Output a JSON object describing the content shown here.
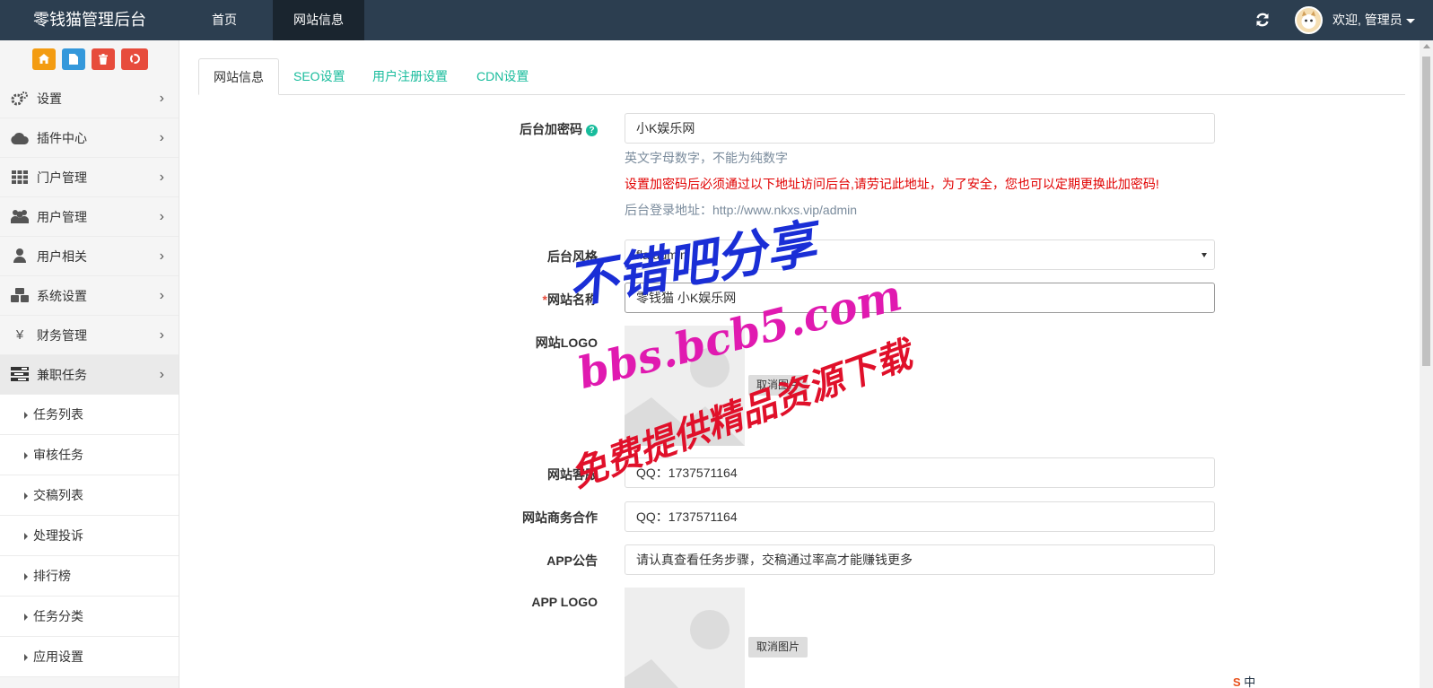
{
  "app": {
    "title": "零钱猫管理后台"
  },
  "topnav": {
    "home": "首页",
    "site_info": "网站信息",
    "welcome": "欢迎, 管理员"
  },
  "sidebar": {
    "items": [
      {
        "label": "设置",
        "icon": "gears-icon"
      },
      {
        "label": "插件中心",
        "icon": "cloud-icon"
      },
      {
        "label": "门户管理",
        "icon": "grid-icon"
      },
      {
        "label": "用户管理",
        "icon": "users-icon"
      },
      {
        "label": "用户相关",
        "icon": "user-icon"
      },
      {
        "label": "系统设置",
        "icon": "cubes-icon"
      },
      {
        "label": "财务管理",
        "icon": "yen-icon"
      },
      {
        "label": "兼职任务",
        "icon": "tasks-icon"
      }
    ],
    "sub_items": [
      "任务列表",
      "审核任务",
      "交稿列表",
      "处理投诉",
      "排行榜",
      "任务分类",
      "应用设置"
    ]
  },
  "tabs": [
    "网站信息",
    "SEO设置",
    "用户注册设置",
    "CDN设置"
  ],
  "form": {
    "admin_code": {
      "label": "后台加密码",
      "value": "小K娱乐网",
      "hint1": "英文字母数字，不能为纯数字",
      "hint2": "设置加密码后必须通过以下地址访问后台,请劳记此地址，为了安全，您也可以定期更换此加密码!",
      "hint3": "后台登录地址：http://www.nkxs.vip/admin"
    },
    "admin_style": {
      "label": "后台风格",
      "value": "flatadmin"
    },
    "site_name": {
      "label": "网站名称",
      "required": "*",
      "value": "零钱猫   小K娱乐网"
    },
    "site_logo": {
      "label": "网站LOGO",
      "cancel": "取消图片"
    },
    "service": {
      "label": "网站客服",
      "value": "QQ：1737571164"
    },
    "business": {
      "label": "网站商务合作",
      "value": "QQ：1737571164"
    },
    "app_notice": {
      "label": "APP公告",
      "value": "请认真查看任务步骤，交稿通过率高才能赚钱更多"
    },
    "app_logo": {
      "label": "APP LOGO",
      "cancel": "取消图片"
    }
  },
  "watermark": {
    "line1": "不错吧分享",
    "line2": "bbs.bcb5.com",
    "line3": "免费提供精品资源下载"
  },
  "tray": {
    "ime": "中"
  }
}
